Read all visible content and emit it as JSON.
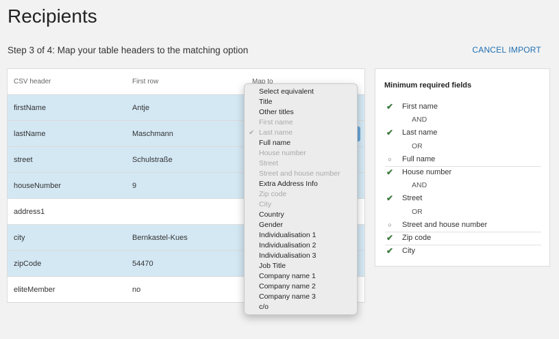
{
  "page": {
    "title": "Recipients",
    "step": "Step 3 of 4: Map your table headers to the matching option",
    "cancel_label": "CANCEL IMPORT"
  },
  "table": {
    "headers": {
      "csv": "CSV header",
      "first": "First row",
      "map": "Map to"
    },
    "rows": [
      {
        "csv": "firstName",
        "first": "Antje",
        "highlighted": true
      },
      {
        "csv": "lastName",
        "first": "Maschmann",
        "highlighted": true
      },
      {
        "csv": "street",
        "first": "Schulstraße",
        "highlighted": true
      },
      {
        "csv": "houseNumber",
        "first": "9",
        "highlighted": true
      },
      {
        "csv": "address1",
        "first": "",
        "highlighted": false
      },
      {
        "csv": "city",
        "first": "Bernkastel-Kues",
        "highlighted": true
      },
      {
        "csv": "zipCode",
        "first": "54470",
        "highlighted": true
      },
      {
        "csv": "eliteMember",
        "first": "no",
        "highlighted": false
      }
    ]
  },
  "dropdown": {
    "options": [
      {
        "label": "Select equivalent",
        "disabled": false
      },
      {
        "label": "Title",
        "disabled": false
      },
      {
        "label": "Other titles",
        "disabled": false
      },
      {
        "label": "First name",
        "disabled": true
      },
      {
        "label": "Last name",
        "disabled": true,
        "checked": true
      },
      {
        "label": "Full name",
        "disabled": false
      },
      {
        "label": "House number",
        "disabled": true
      },
      {
        "label": "Street",
        "disabled": true
      },
      {
        "label": "Street and house number",
        "disabled": true
      },
      {
        "label": "Extra Address Info",
        "disabled": false
      },
      {
        "label": "Zip code",
        "disabled": true
      },
      {
        "label": "City",
        "disabled": true
      },
      {
        "label": "Country",
        "disabled": false
      },
      {
        "label": "Gender",
        "disabled": false
      },
      {
        "label": "Individualisation 1",
        "disabled": false
      },
      {
        "label": "Individualisation 2",
        "disabled": false
      },
      {
        "label": "Individualisation 3",
        "disabled": false
      },
      {
        "label": "Job Title",
        "disabled": false
      },
      {
        "label": "Company name 1",
        "disabled": false
      },
      {
        "label": "Company name 2",
        "disabled": false
      },
      {
        "label": "Company name 3",
        "disabled": false
      },
      {
        "label": "c/o",
        "disabled": false
      }
    ]
  },
  "required": {
    "title": "Minimum required fields",
    "items": [
      {
        "type": "check",
        "label": "First name"
      },
      {
        "type": "conj",
        "label": "AND"
      },
      {
        "type": "check",
        "label": "Last name"
      },
      {
        "type": "conj",
        "label": "OR"
      },
      {
        "type": "circle",
        "label": "Full name",
        "separator": true
      },
      {
        "type": "check",
        "label": "House number"
      },
      {
        "type": "conj",
        "label": "AND"
      },
      {
        "type": "check",
        "label": "Street"
      },
      {
        "type": "conj",
        "label": "OR"
      },
      {
        "type": "circle",
        "label": "Street and house number",
        "separator": true
      },
      {
        "type": "check",
        "label": "Zip code",
        "separator": true
      },
      {
        "type": "check",
        "label": "City"
      }
    ]
  },
  "colors": {
    "accent": "#1f6fb0",
    "row_highlight": "#d4e8f4",
    "check": "#3d7a3d"
  },
  "icons": {
    "check": "checkmark-icon",
    "circle": "empty-circle-icon"
  }
}
